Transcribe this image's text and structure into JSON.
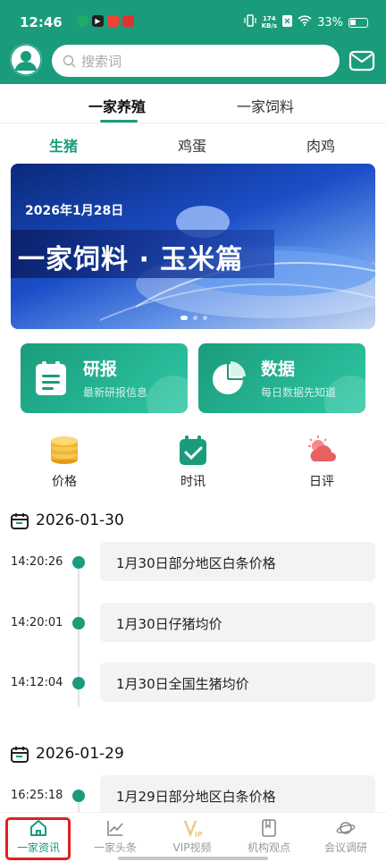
{
  "status_bar": {
    "time": "12:46",
    "net_speed_value": "174",
    "net_speed_unit": "KB/s",
    "battery": "33%"
  },
  "search": {
    "placeholder": "搜索词"
  },
  "top_tabs": [
    {
      "label": "一家养殖"
    },
    {
      "label": "一家饲料"
    }
  ],
  "sub_tabs": [
    {
      "label": "生猪"
    },
    {
      "label": "鸡蛋"
    },
    {
      "label": "肉鸡"
    }
  ],
  "banner": {
    "date": "2026年1月28日",
    "title": "一家饲料 · 玉米篇",
    "page_count": 3,
    "active_page": 1
  },
  "cards": [
    {
      "title": "研报",
      "subtitle": "最新研报信息"
    },
    {
      "title": "数据",
      "subtitle": "每日数据先知道"
    }
  ],
  "quick_links": [
    {
      "label": "价格"
    },
    {
      "label": "时讯"
    },
    {
      "label": "日评"
    }
  ],
  "news_groups": [
    {
      "date": "2026-01-30",
      "items": [
        {
          "time": "14:20:26",
          "title": "1月30日部分地区白条价格"
        },
        {
          "time": "14:20:01",
          "title": "1月30日仔猪均价"
        },
        {
          "time": "14:12:04",
          "title": "1月30日全国生猪均价"
        }
      ]
    },
    {
      "date": "2026-01-29",
      "items": [
        {
          "time": "16:25:18",
          "title": "1月29日部分地区白条价格"
        }
      ]
    }
  ],
  "bottom_nav": [
    {
      "label": "一家资讯"
    },
    {
      "label": "一家头条"
    },
    {
      "label": "VIP视频"
    },
    {
      "label": "机构观点"
    },
    {
      "label": "会议调研"
    }
  ],
  "colors": {
    "brand": "#1a9c7c",
    "highlight_border": "#e02020"
  }
}
